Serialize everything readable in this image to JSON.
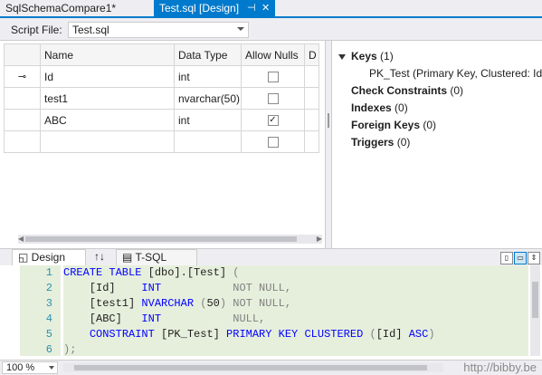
{
  "tabs": {
    "inactive": "SqlSchemaCompare1*",
    "active": "Test.sql [Design]",
    "pin_glyph": "⊣",
    "close_glyph": "✕"
  },
  "script_file": {
    "label": "Script File:",
    "value": "Test.sql"
  },
  "grid": {
    "headers": [
      "Name",
      "Data Type",
      "Allow Nulls",
      "D"
    ],
    "rows": [
      {
        "key": true,
        "name": "Id",
        "type": "int",
        "nullable": false
      },
      {
        "key": false,
        "name": "test1",
        "type": "nvarchar(50)",
        "nullable": false
      },
      {
        "key": false,
        "name": "ABC",
        "type": "int",
        "nullable": true
      },
      {
        "key": false,
        "name": "",
        "type": "",
        "nullable": false
      }
    ],
    "key_glyph": "⊸"
  },
  "tree": {
    "keys": {
      "label": "Keys",
      "count": "(1)"
    },
    "pk": "PK_Test  (Primary Key, Clustered: Id)",
    "check": {
      "label": "Check Constraints",
      "count": "(0)"
    },
    "indexes": {
      "label": "Indexes",
      "count": "(0)"
    },
    "fk": {
      "label": "Foreign Keys",
      "count": "(0)"
    },
    "triggers": {
      "label": "Triggers",
      "count": "(0)"
    }
  },
  "bottom_tabs": {
    "design": "Design",
    "swap": "↑↓",
    "tsql": "T-SQL"
  },
  "code": {
    "line_numbers": [
      "1",
      "2",
      "3",
      "4",
      "5",
      "6"
    ]
  },
  "status": {
    "zoom": "100 %",
    "watermark": "http://bibby.be"
  },
  "colors": {
    "accent": "#007acc",
    "keyword": "#0000ff",
    "editor_bg": "#e6efdc"
  }
}
